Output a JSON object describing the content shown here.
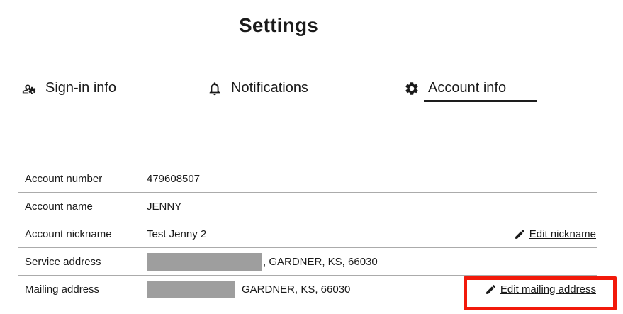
{
  "title": "Settings",
  "tabs": [
    {
      "label": "Sign-in info",
      "icon": "manage-accounts-icon",
      "active": false
    },
    {
      "label": "Notifications",
      "icon": "bell-icon",
      "active": false
    },
    {
      "label": "Account info",
      "icon": "gear-icon",
      "active": true
    }
  ],
  "active_tab": "Account info",
  "table": {
    "rows": [
      {
        "label": "Account number",
        "value": "479608507"
      },
      {
        "label": "Account name",
        "value": "JENNY"
      },
      {
        "label": "Account nickname",
        "value": "Test Jenny 2",
        "action_label": "Edit nickname",
        "action_icon": "pencil-icon"
      },
      {
        "label": "Service address",
        "value_redacted": true,
        "value_suffix": ", GARDNER, KS, 66030"
      },
      {
        "label": "Mailing address",
        "value_redacted": true,
        "value_suffix": "GARDNER, KS, 66030",
        "action_label": "Edit mailing address",
        "action_icon": "pencil-icon",
        "highlighted": true
      }
    ]
  },
  "colors": {
    "text": "#1a1a1a",
    "divider": "#ababab",
    "redaction_box": "#9e9e9e",
    "active_tab_underline": "#1d1d1d",
    "annotation_highlight": "#f2190a"
  }
}
